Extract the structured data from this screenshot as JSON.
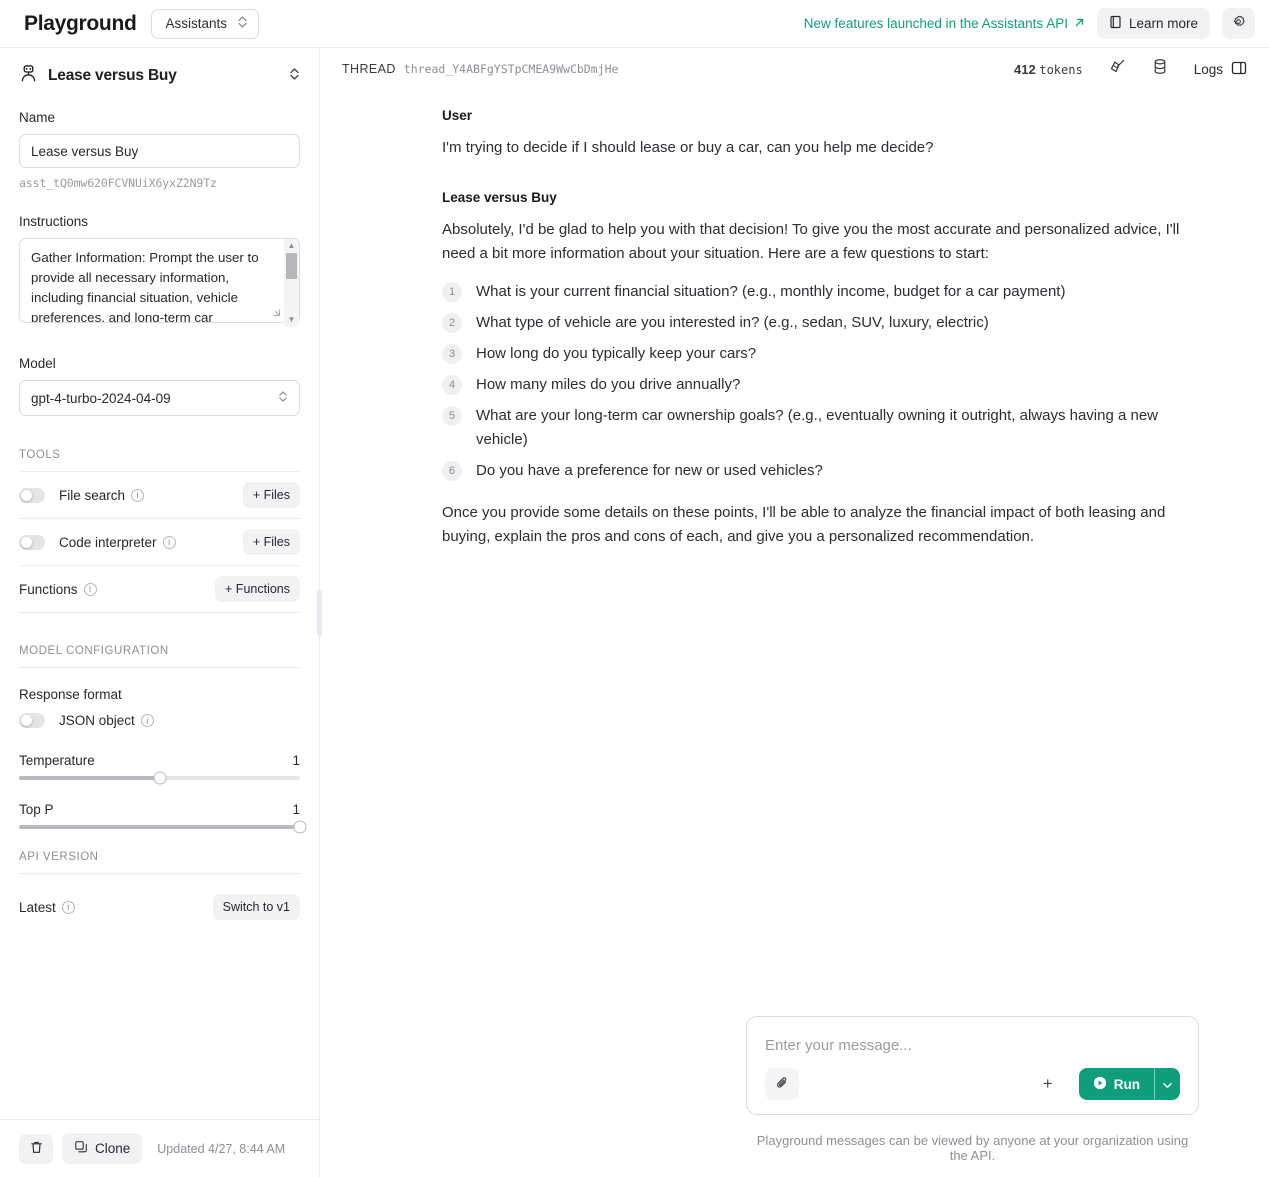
{
  "topbar": {
    "brand": "Playground",
    "mode_selected": "Assistants",
    "feature_link": "New features launched in the Assistants API",
    "learn_more": "Learn more",
    "settings_icon": "gear-icon",
    "external_link_icon": "arrow-up-right-icon",
    "book_icon": "book-icon"
  },
  "sidebar": {
    "assistant_title": "Lease versus Buy",
    "assistant_icon": "robot-icon",
    "name_label": "Name",
    "name_value": "Lease versus Buy",
    "assistant_id": "asst_tQ0mw620FCVNUiX6yxZ2N9Tz",
    "instructions_label": "Instructions",
    "instructions_value": "Gather Information: Prompt the user to provide all necessary information, including financial situation, vehicle preferences, and long-term car ownership goals.",
    "model_label": "Model",
    "model_value": "gpt-4-turbo-2024-04-09",
    "tools_caption": "TOOLS",
    "tools": [
      {
        "label": "File search",
        "action": "+ Files",
        "enabled": false
      },
      {
        "label": "Code interpreter",
        "action": "+ Files",
        "enabled": false
      }
    ],
    "functions_label": "Functions",
    "functions_action": "+ Functions",
    "model_config_caption": "MODEL CONFIGURATION",
    "response_format_label": "Response format",
    "json_object_label": "JSON object",
    "json_object_enabled": false,
    "temperature_label": "Temperature",
    "temperature_value": "1",
    "temperature_percent": 50,
    "top_p_label": "Top P",
    "top_p_value": "1",
    "top_p_percent": 100,
    "api_version_caption": "API VERSION",
    "api_version_label": "Latest",
    "switch_button": "Switch to v1",
    "delete_icon": "trash-icon",
    "clone_label": "Clone",
    "clone_icon": "copy-icon",
    "updated_text": "Updated 4/27, 8:44 AM"
  },
  "thread": {
    "caption": "THREAD",
    "id": "thread_Y4ABFgYSTpCMEA9WwCbDmjHe",
    "token_count": "412",
    "token_unit": "tokens",
    "clear_icon": "broom-icon",
    "storage_icon": "database-icon",
    "logs_label": "Logs",
    "panel_icon": "panel-right-icon"
  },
  "messages": [
    {
      "role": "User",
      "paragraphs": [
        "I'm trying to decide if I should lease or buy a car, can you help me decide?"
      ],
      "list": [],
      "closing": ""
    },
    {
      "role": "Lease versus Buy",
      "paragraphs": [
        "Absolutely, I'd be glad to help you with that decision! To give you the most accurate and personalized advice, I'll need a bit more information about your situation. Here are a few questions to start:"
      ],
      "list": [
        "What is your current financial situation? (e.g., monthly income, budget for a car payment)",
        "What type of vehicle are you interested in? (e.g., sedan, SUV, luxury, electric)",
        "How long do you typically keep your cars?",
        "How many miles do you drive annually?",
        "What are your long-term car ownership goals? (e.g., eventually owning it outright, always having a new vehicle)",
        "Do you have a preference for new or used vehicles?"
      ],
      "closing": "Once you provide some details on these points, I'll be able to analyze the financial impact of both leasing and buying, explain the pros and cons of each, and give you a personalized recommendation."
    }
  ],
  "composer": {
    "placeholder": "Enter your message...",
    "attach_icon": "paperclip-icon",
    "add_label": "+",
    "run_label": "Run",
    "run_icon": "play-circle-icon",
    "caret_icon": "chevron-down-icon"
  },
  "footer_note": "Playground messages can be viewed by anyone at your organization using the API.",
  "colors": {
    "accent_green": "#0f9d7c",
    "link_green": "#0f9d7c",
    "border": "#dcdce3",
    "muted": "#8e8e98"
  }
}
